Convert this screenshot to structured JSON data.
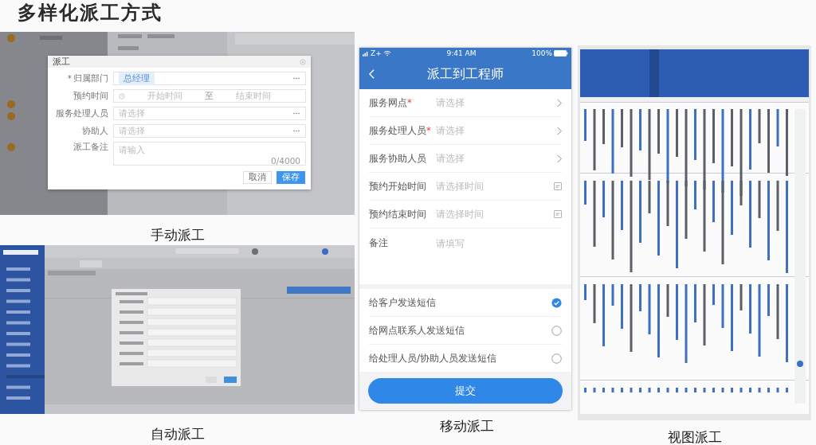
{
  "title": "多样化派工方式",
  "manual": {
    "caption": "手动派工",
    "dialog": {
      "title": "派工",
      "fields": [
        {
          "label": "归属部门",
          "required_mark": "*",
          "kind": "tag",
          "tag": "总经理"
        },
        {
          "label": "预约时间",
          "kind": "range",
          "start": "开始时间",
          "separator": "至",
          "end": "结束时间"
        },
        {
          "label": "服务处理人员",
          "kind": "select",
          "placeholder": "请选择"
        },
        {
          "label": "协助人",
          "kind": "select",
          "placeholder": "请选择"
        },
        {
          "label": "派工备注",
          "kind": "textarea",
          "placeholder": "请输入",
          "counter": "0/4000"
        }
      ],
      "buttons": [
        {
          "label": "取消",
          "primary": false
        },
        {
          "label": "保存",
          "primary": true
        }
      ]
    }
  },
  "auto": {
    "caption": "自动派工"
  },
  "mobile": {
    "status": {
      "carrier": "Z+",
      "time": "9:41 AM",
      "battery": "100%"
    },
    "title": "派工到工程师",
    "fields": [
      {
        "label": "服务网点",
        "required_mark": "*",
        "placeholder": "请选择",
        "kind": "select"
      },
      {
        "label": "服务处理人员",
        "required_mark": "*",
        "placeholder": "请选择",
        "kind": "select"
      },
      {
        "label": "服务协助人员",
        "placeholder": "请选择",
        "kind": "select"
      },
      {
        "label": "预约开始时间",
        "placeholder": "请选择时间",
        "kind": "date"
      },
      {
        "label": "预约结束时间",
        "placeholder": "请选择时间",
        "kind": "date"
      },
      {
        "label": "备注",
        "placeholder": "请填写",
        "kind": "text"
      }
    ],
    "sms": [
      {
        "label": "给客户发送短信",
        "checked": true
      },
      {
        "label": "给网点联系人发送短信",
        "checked": false
      },
      {
        "label": "给处理人员/协助人员发送短信",
        "checked": false
      }
    ],
    "submit": "提交",
    "caption": "移动派工"
  },
  "view": {
    "caption": "视图派工"
  }
}
